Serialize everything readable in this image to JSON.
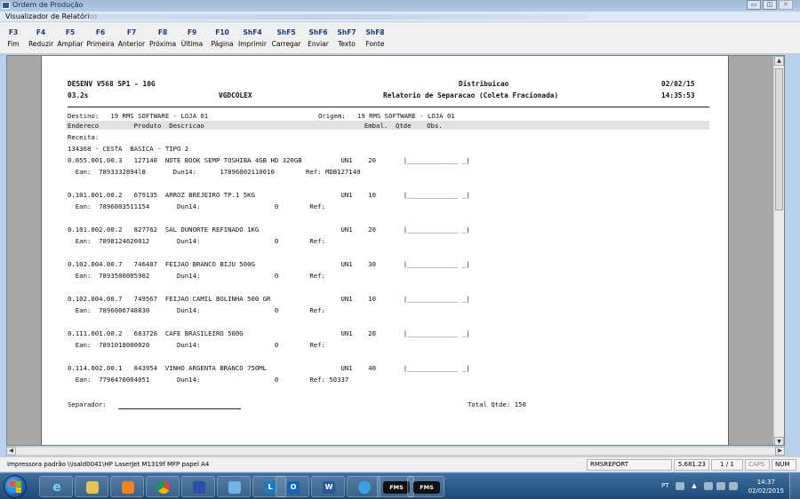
{
  "window": {
    "outer_title": "Ordem de Produção",
    "inner_title": "Visualizador de Relatórios",
    "min_glyph": "▭",
    "max_glyph": "◫",
    "close_glyph": "✕"
  },
  "toolbar": [
    {
      "key": "F3",
      "label": "Fim"
    },
    {
      "key": "F4",
      "label": "Reduzir"
    },
    {
      "key": "F5",
      "label": "Ampliar"
    },
    {
      "key": "F6",
      "label": "Primeira"
    },
    {
      "key": "F7",
      "label": "Anterior"
    },
    {
      "key": "F8",
      "label": "Próxima"
    },
    {
      "key": "F9",
      "label": "Última"
    },
    {
      "key": "F10",
      "label": "Página"
    },
    {
      "key": "ShF4",
      "label": "Imprimir"
    },
    {
      "key": "ShF5",
      "label": "Carregar"
    },
    {
      "key": "ShF6",
      "label": "Enviar"
    },
    {
      "key": "ShF7",
      "label": "Texto"
    },
    {
      "key": "ShF8",
      "label": "Fonte"
    }
  ],
  "report": {
    "system": "DESENV V568 SP1 - 10G",
    "version": "03.2s",
    "program": "VGDCOLEX",
    "module": "Distribuicao",
    "title": "Relatorio de Separacao (Coleta Fracionada)",
    "date": "02/02/15",
    "time": "14:35:53",
    "destino_line": "Destino:   19 RMS SOFTWARE - LOJA 01",
    "origem_line": "Origem:   19 RMS SOFTWARE - LOJA 01",
    "header_columns": "Endereco         Produto  Descricao                                         Embal.  Qtde    Obs.",
    "receita_label": "Receita:",
    "receita_line": "134368 - CESTA  BASICA - TIPO 2",
    "items": [
      {
        "main": "0.055.001.00.3   127140  NOTE BOOK SEMP TOSHIBA 4GB HD 320GB          UN1    20       |_____________ _|",
        "ean": "  Ean:  7893332894l8       Dun14:      17896002110010        Ref: MDB127140"
      },
      {
        "main": "0.101.001.00.2   679135  ARROZ BREJEIRO TP.1 5KG                      UN1    10       |_____________ _|",
        "ean": "  Ean:  7896003511154       Dun14:                   0        Ref:"
      },
      {
        "main": "0.101.002.00.2   827762  SAL DUNORTE REFINADO 1KG                     UN1    20       |_____________ _|",
        "ean": "  Ean:  7898124620012       Dun14:                   0        Ref:"
      },
      {
        "main": "0.102.004.00.7   746487  FEIJAO BRANCO BIJU 500G                      UN1    30       |_____________ _|",
        "ean": "  Ean:  7893500005902       Dun14:                   0        Ref:"
      },
      {
        "main": "0.102.004.00.7   749567  FEIJAO CAMIL BOLINHA 500 GR                  UN1    10       |_____________ _|",
        "ean": "  Ean:  7896006748830       Dun14:                   0        Ref:"
      },
      {
        "main": "0.111.001.00.2   683728  CAFE BRASILEIRO 500G                         UN1    20       |_____________ _|",
        "ean": "  Ean:  7891018000020       Dun14:                   0        Ref:"
      },
      {
        "main": "0.114.002.00.1   843954  VINHO ARGENTA BRANCO 750ML                   UN1    40       |_____________ _|",
        "ean": "  Ean:  7790470004051       Dun14:                   0        Ref: 50337"
      }
    ],
    "separador_label": "Separador:",
    "total_label": "Total Qtde: 150"
  },
  "statusbar": {
    "printer": "Impressora padrão \\\\isald0041\\HP LaserJet M1319f MFP papel A4",
    "report_name": "RMSREPORT",
    "size": "5.681.23",
    "pages": "1 / 1",
    "caps": "CAPS",
    "num": "NUM"
  },
  "taskbar": {
    "lang": "PT",
    "time": "14:37",
    "date": "02/02/2015",
    "fms_label": "FMS"
  },
  "colors": {
    "toolbar_key": "#1b3b7a",
    "taskbar": "#1d4a79",
    "page_band": "#e1e1e1"
  }
}
